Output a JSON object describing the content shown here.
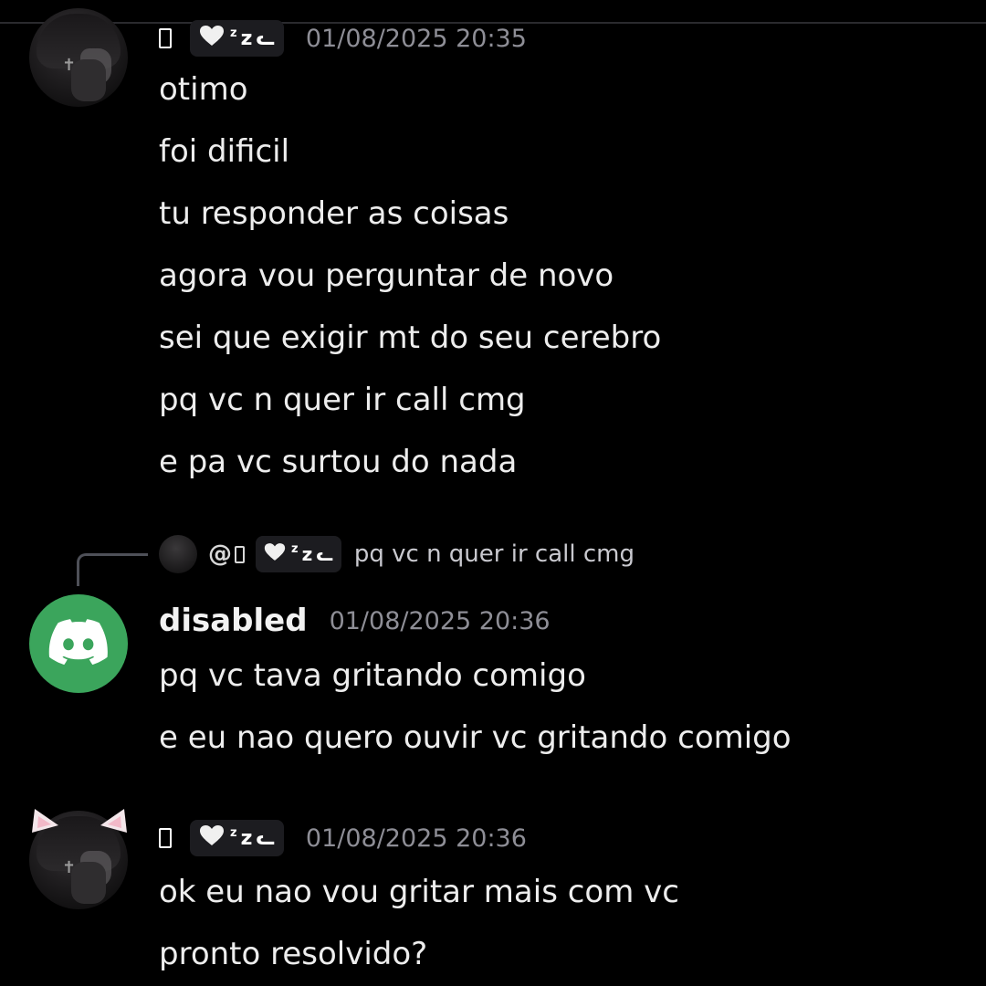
{
  "colors": {
    "background": "#000000",
    "discord_green": "#3ba55c",
    "timestamp": "#8e8e96",
    "tag_bg": "#1c1c20",
    "reply_line": "#4e5058"
  },
  "messages": [
    {
      "author_glyph": "▯",
      "tag": {
        "icon": "heart-icon",
        "text": "z",
        "sup": "z",
        "suffix": "ᓚ"
      },
      "timestamp": "01/08/2025 20:35",
      "lines": [
        "otimo",
        "foi dificil",
        "tu responder as coisas",
        "agora vou perguntar de novo",
        "sei que exigir mt do seu cerebro",
        "pq vc n quer ir call cmg",
        "e pa vc surtou do nada"
      ]
    },
    {
      "reply": {
        "handle": "@",
        "tag_text": "z",
        "tag_sup": "z",
        "tag_suffix": "ᓚ",
        "text": "pq vc n quer ir call cmg"
      },
      "username": "disabled",
      "timestamp": "01/08/2025 20:36",
      "lines": [
        "pq vc tava gritando comigo",
        "e eu nao quero ouvir vc gritando comigo"
      ]
    },
    {
      "author_glyph": "▯",
      "tag": {
        "icon": "heart-icon",
        "text": "z",
        "sup": "z",
        "suffix": "ᓚ"
      },
      "timestamp": "01/08/2025 20:36",
      "lines": [
        "ok eu nao vou gritar mais com vc",
        "pronto resolvido?"
      ]
    }
  ]
}
